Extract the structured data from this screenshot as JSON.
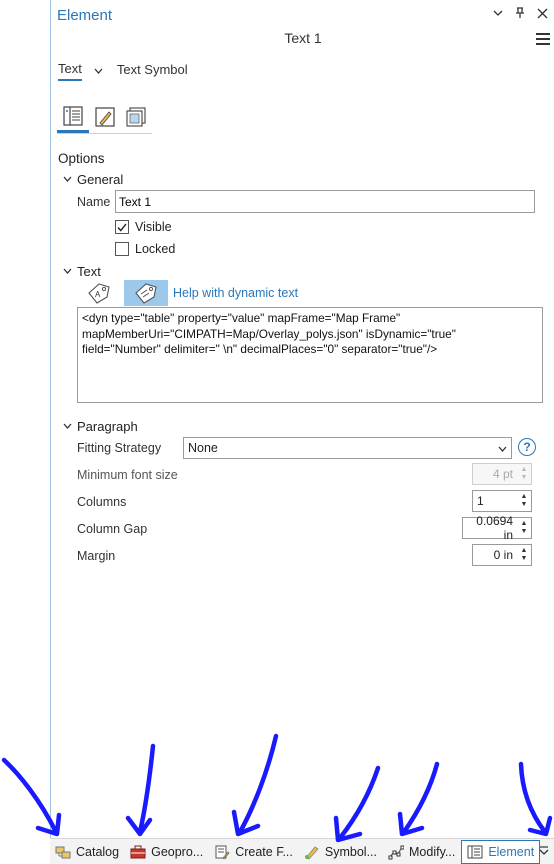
{
  "pane": {
    "title": "Element",
    "element_name": "Text 1",
    "tabs": [
      {
        "label": "Text",
        "active": true
      },
      {
        "label": "Text Symbol",
        "active": false
      }
    ]
  },
  "options": {
    "heading": "Options",
    "general": {
      "heading": "General",
      "name_label": "Name",
      "name_value": "Text 1",
      "visible_label": "Visible",
      "visible_checked": true,
      "locked_label": "Locked",
      "locked_checked": false
    },
    "text": {
      "heading": "Text",
      "help_link": "Help with dynamic text",
      "content": "<dyn type=\"table\" property=\"value\" mapFrame=\"Map Frame\" mapMemberUri=\"CIMPATH=Map/Overlay_polys.json\" isDynamic=\"true\" field=\"Number\" delimiter=\" \\n\" decimalPlaces=\"0\" separator=\"true\"/>"
    },
    "paragraph": {
      "heading": "Paragraph",
      "fitting_label": "Fitting Strategy",
      "fitting_value": "None",
      "min_font_label": "Minimum font size",
      "min_font_value": "4 pt",
      "columns_label": "Columns",
      "columns_value": "1",
      "column_gap_label": "Column Gap",
      "column_gap_value": "0.0694 in",
      "margin_label": "Margin",
      "margin_value": "0 in"
    }
  },
  "bottom_tabs": [
    {
      "label": "Catalog",
      "icon": "catalog-icon"
    },
    {
      "label": "Geopro...",
      "icon": "toolbox-icon"
    },
    {
      "label": "Create F...",
      "icon": "create-features-icon"
    },
    {
      "label": "Symbol...",
      "icon": "symbology-icon"
    },
    {
      "label": "Modify...",
      "icon": "modify-features-icon"
    },
    {
      "label": "Element",
      "icon": "element-icon",
      "active": true
    }
  ],
  "colors": {
    "accent": "#2b77b8",
    "annotation_arrows": "#1a1aff"
  }
}
